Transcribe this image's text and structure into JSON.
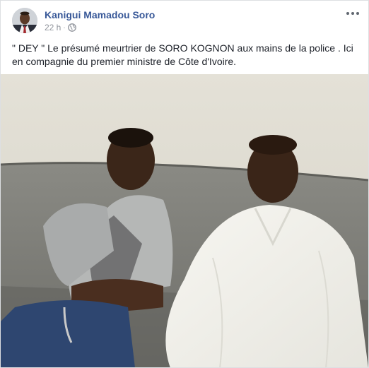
{
  "post": {
    "author": "Kanigui Mamadou Soro",
    "timestamp": "22 h",
    "separator": "·",
    "privacy_icon": "globe-icon",
    "more_icon": "more-options-icon",
    "text": "\" DEY \" Le présumé meurtrier de SORO KOGNON aux mains de la police . Ici en compagnie du premier ministre de Côte d'Ivoire."
  },
  "colors": {
    "author_link": "#385898",
    "meta_text": "#90949c",
    "body_text": "#1d2129"
  }
}
